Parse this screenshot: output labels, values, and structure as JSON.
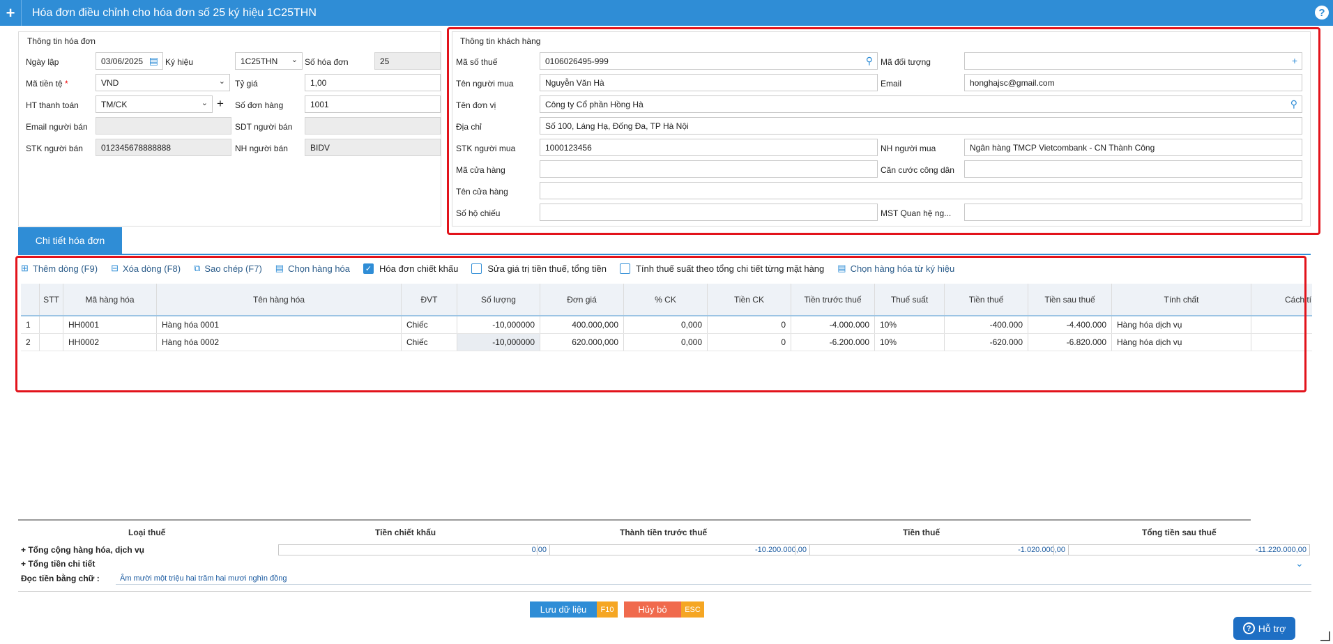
{
  "window": {
    "title": "Hóa đơn điều chỉnh cho hóa đơn số 25 ký hiệu 1C25THN"
  },
  "invoice_info": {
    "legend": "Thông tin hóa đơn",
    "date_label": "Ngày lập",
    "date_value": "03/06/2025",
    "symbol_label": "Ký hiệu",
    "symbol_value": "1C25THN",
    "invoice_no_label": "Số hóa đơn",
    "invoice_no_value": "25",
    "currency_label": "Mã tiền tệ",
    "currency_required": "*",
    "currency_value": "VND",
    "rate_label": "Tỷ giá",
    "rate_value": "1,00",
    "payment_label": "HT thanh toán",
    "payment_value": "TM/CK",
    "order_no_label": "Số đơn hàng",
    "order_no_value": "1001",
    "seller_email_label": "Email người bán",
    "seller_email_value": "",
    "seller_phone_label": "SDT người bán",
    "seller_phone_value": "",
    "seller_account_label": "STK người bán",
    "seller_account_value": "012345678888888",
    "seller_bank_label": "NH người bán",
    "seller_bank_value": "BIDV"
  },
  "customer_info": {
    "legend": "Thông tin khách hàng",
    "tax_code_label": "Mã số thuế",
    "tax_code_value": "0106026495-999",
    "object_code_label": "Mã đối tượng",
    "object_code_value": "",
    "buyer_name_label": "Tên người mua",
    "buyer_name_value": "Nguyễn Văn Hà",
    "email_label": "Email",
    "email_value": "honghajsc@gmail.com",
    "company_label": "Tên đơn vị",
    "company_value": "Công ty Cổ phần Hồng Hà",
    "address_label": "Địa chỉ",
    "address_value": "Số 100, Láng Hạ, Đống Đa, TP Hà Nội",
    "buyer_account_label": "STK người mua",
    "buyer_account_value": "1000123456",
    "buyer_bank_label": "NH người mua",
    "buyer_bank_value": "Ngân hàng TMCP Vietcombank - CN Thành Công",
    "store_code_label": "Mã cửa hàng",
    "store_code_value": "",
    "citizen_id_label": "Căn cước công dân",
    "citizen_id_value": "",
    "store_name_label": "Tên cửa hàng",
    "store_name_value": "",
    "passport_label": "Số hộ chiếu",
    "passport_value": "",
    "mst_relation_label": "MST Quan hệ ng...",
    "mst_relation_value": ""
  },
  "detail_tab": {
    "label": "Chi tiết hóa đơn"
  },
  "toolbar": {
    "add_row": "Thêm dòng (F9)",
    "delete_row": "Xóa dòng (F8)",
    "copy": "Sao chép (F7)",
    "choose_goods": "Chọn hàng hóa",
    "discount_invoice": "Hóa đơn chiết khấu",
    "edit_tax_total": "Sửa giá trị tiền thuế, tổng tiền",
    "tax_by_item": "Tính thuế suất theo tổng chi tiết từng mặt hàng",
    "choose_goods_by_symbol": "Chọn hàng hóa từ ký hiệu",
    "discount_invoice_checked": true,
    "edit_tax_total_checked": false,
    "tax_by_item_checked": false
  },
  "grid": {
    "columns": [
      "STT",
      "Mã hàng hóa",
      "Tên hàng hóa",
      "ĐVT",
      "Số lượng",
      "Đơn giá",
      "% CK",
      "Tiền CK",
      "Tiền trước thuế",
      "Thuế suất",
      "Tiền thuế",
      "Tiền sau thuế",
      "Tính chất",
      "Cách tí"
    ],
    "rows": [
      {
        "idx": "1",
        "stt": "",
        "code": "HH0001",
        "name": "Hàng hóa 0001",
        "unit": "Chiếc",
        "qty": "-10,000000",
        "price": "400.000,000",
        "ck_pct": "0,000",
        "ck_amt": "0",
        "before_tax": "-4.000.000",
        "tax_rate": "10%",
        "tax": "-400.000",
        "after_tax": "-4.400.000",
        "nature": "Hàng hóa dịch vụ",
        "calc": ""
      },
      {
        "idx": "2",
        "stt": "",
        "code": "HH0002",
        "name": "Hàng hóa 0002",
        "unit": "Chiếc",
        "qty": "-10,000000",
        "price": "620.000,000",
        "ck_pct": "0,000",
        "ck_amt": "0",
        "before_tax": "-6.200.000",
        "tax_rate": "10%",
        "tax": "-620.000",
        "after_tax": "-6.820.000",
        "nature": "Hàng hóa dịch vụ",
        "calc": ""
      }
    ]
  },
  "summary": {
    "headers": [
      "Loại thuế",
      "Tiền chiết khấu",
      "Thành tiền trước thuế",
      "Tiền thuế",
      "Tổng tiền sau thuế"
    ],
    "total_goods_label": "+ Tổng cộng hàng hóa, dịch vụ",
    "discount": "0,00",
    "before_tax": "-10.200.000,00",
    "tax": "-1.020.000,00",
    "after_tax": "-11.220.000,00",
    "total_detail_label": "+ Tổng tiền chi tiết",
    "read_words_label": "Đọc tiền bằng chữ :",
    "read_words_value": "Âm mười một triệu hai trăm hai mươi nghìn đồng"
  },
  "actions": {
    "save_label": "Lưu dữ liệu",
    "save_key": "F10",
    "cancel_label": "Hủy bỏ",
    "cancel_key": "ESC",
    "save_color": "#2f8dd6",
    "cancel_color": "#f06a4d"
  },
  "support": {
    "label": "Hỗ trợ"
  },
  "colors": {
    "accent": "#2f8dd6",
    "highlight_box": "#e2131b"
  }
}
